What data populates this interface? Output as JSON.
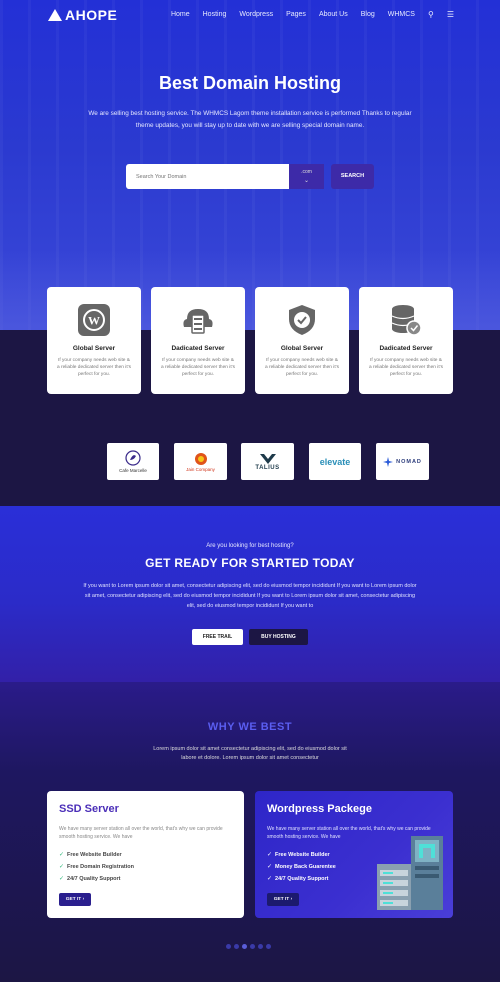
{
  "nav": {
    "logo": "AHOPE",
    "links": [
      "Home",
      "Hosting",
      "Wordpress",
      "Pages",
      "About Us",
      "Blog",
      "WHMCS"
    ]
  },
  "hero": {
    "title": "Best Domain Hosting",
    "subtitle": "We are selling best hosting service. The WHMCS Lagom theme installation service is performed Thanks to regular theme updates, you will stay up to date with we are selling special domain name.",
    "search_placeholder": "Search Your Domain",
    "tld": ".com",
    "search_button": "SEARCH"
  },
  "features": [
    {
      "title": "Global Server",
      "text": "If your company needs web site & a reliable dedicated server then it's perfect for you.",
      "icon": "wordpress-icon"
    },
    {
      "title": "Dadicated Server",
      "text": "If your company needs web site & a reliable dedicated server then it's perfect for you.",
      "icon": "server-icon"
    },
    {
      "title": "Global Server",
      "text": "If your company needs web site & a reliable dedicated server then it's perfect for you.",
      "icon": "shield-check-icon"
    },
    {
      "title": "Dadicated Server",
      "text": "If your company needs web site & a reliable dedicated server then it's perfect for you.",
      "icon": "database-check-icon"
    }
  ],
  "brands": [
    "Cafe Marcelle",
    "Jain Company",
    "TALIUS",
    "elevate",
    "NOMAD"
  ],
  "cta": {
    "pre": "Are you looking for best hosting?",
    "title": "GET READY FOR STARTED TODAY",
    "text": "If you want to Lorem ipsum dolor sit amet, consectetur adipiscing elit, sed do eiusmod tempor incididunt If you want to Lorem ipsum dolor sit amet, consectetur adipiscing elit, sed do eiusmod tempor incididunt If you want to Lorem ipsum dolor sit amet, consectetur adipiscing elit, sed do eiusmod tempor incididunt If you want to",
    "btn_trial": "FREE TRAIL",
    "btn_buy": "BUY HOSTING"
  },
  "why": {
    "title": "WHY WE BEST",
    "subtitle": "Lorem ipsum dolor sit amet consectetur adipiscing elit, sed do eiusmod dolor sit labore et dolore. Lorem ipsum dolor sit amet consectetur"
  },
  "plans": [
    {
      "title": "SSD Server",
      "desc": "We have many server station all over the world, that's why we can provide smooth hosting service. We have",
      "features": [
        "Free Website Builder",
        "Free Domain Registration",
        "24/7 Quality Support"
      ],
      "button": "GET IT"
    },
    {
      "title": "Wordpress Packege",
      "desc": "We have many server station all over the world, that's why we can provide smooth hosting service. We have",
      "features": [
        "Free Website Builder",
        "Money Back Guarentee",
        "24/7 Quality Support"
      ],
      "button": "GET IT"
    }
  ],
  "carousel": {
    "active_index": 2,
    "count": 6
  }
}
